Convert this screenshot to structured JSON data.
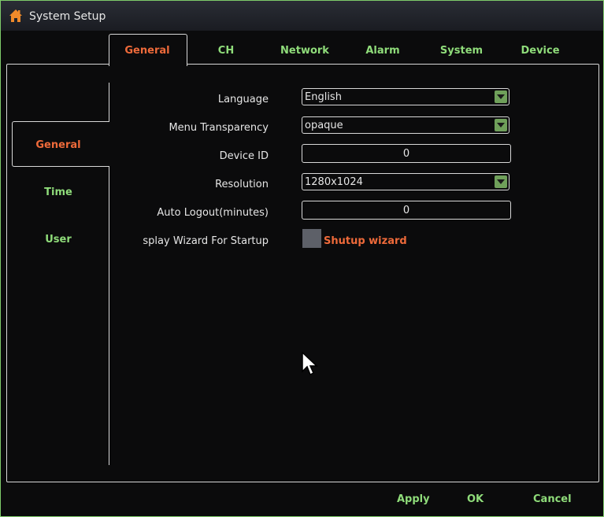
{
  "window": {
    "title": "System Setup"
  },
  "tabs": [
    {
      "label": "General",
      "active": true
    },
    {
      "label": "CH"
    },
    {
      "label": "Network"
    },
    {
      "label": "Alarm"
    },
    {
      "label": "System"
    },
    {
      "label": "Device"
    }
  ],
  "sidebar": {
    "items": [
      {
        "label": "General",
        "active": true
      },
      {
        "label": "Time"
      },
      {
        "label": "User"
      }
    ]
  },
  "form": {
    "language": {
      "label": "Language",
      "value": "English"
    },
    "menu_transparency": {
      "label": "Menu Transparency",
      "value": "opaque"
    },
    "device_id": {
      "label": "Device ID",
      "value": "0"
    },
    "resolution": {
      "label": "Resolution",
      "value": "1280x1024"
    },
    "auto_logout": {
      "label": "Auto Logout(minutes)",
      "value": "0"
    },
    "wizard": {
      "label": "splay Wizard For Startup",
      "checkbox_label": "Shutup wizard"
    }
  },
  "footer": {
    "apply": "Apply",
    "ok": "OK",
    "cancel": "Cancel"
  },
  "colors": {
    "accent_active": "#ee6a3a",
    "accent_inactive": "#8fdc7a",
    "border": "#7ecb6a"
  },
  "icons": {
    "title": "home-icon",
    "dropdown": "chevron-down-icon",
    "pointer": "mouse-pointer-icon"
  }
}
